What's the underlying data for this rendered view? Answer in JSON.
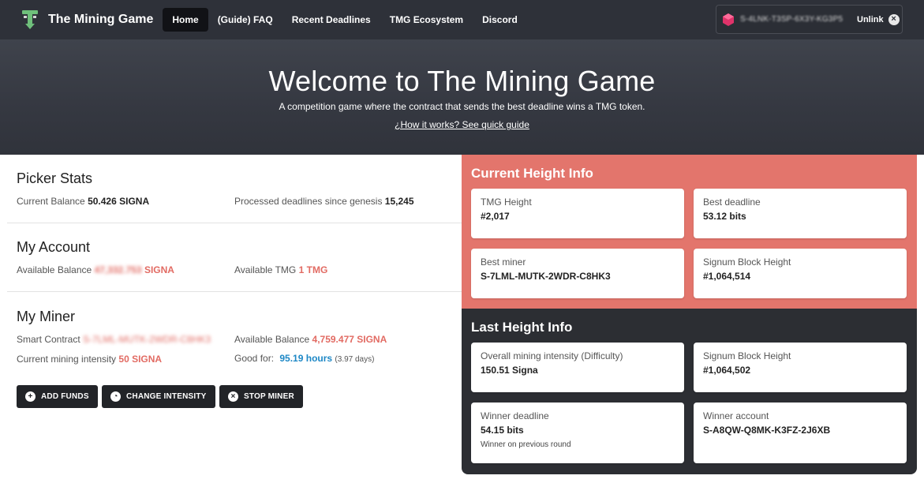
{
  "nav": {
    "brand": "The Mining Game",
    "links": [
      "Home",
      "(Guide) FAQ",
      "Recent Deadlines",
      "TMG Ecosystem",
      "Discord"
    ],
    "wallet_address": "S-4LNK-T3SP-6X3Y-KG3P5",
    "unlink_label": "Unlink"
  },
  "hero": {
    "title": "Welcome to The Mining Game",
    "subtitle": "A competition game where the contract that sends the best deadline wins a TMG token.",
    "guide_link": "¿How it works? See quick guide"
  },
  "picker_stats": {
    "title": "Picker Stats",
    "current_balance_label": "Current Balance",
    "current_balance_value": "50.426 SIGNA",
    "processed_label": "Processed deadlines since genesis",
    "processed_value": "15,245"
  },
  "my_account": {
    "title": "My Account",
    "available_balance_label": "Available Balance",
    "available_balance_value": "47,332.753",
    "available_balance_unit": "SIGNA",
    "available_tmg_label": "Available TMG",
    "available_tmg_value": "1 TMG"
  },
  "my_miner": {
    "title": "My Miner",
    "smart_contract_label": "Smart Contract",
    "smart_contract_value": "S-7LML-MUTK-2WDR-C8HK3",
    "available_balance_label": "Available Balance",
    "available_balance_value": "4,759.477 SIGNA",
    "intensity_label": "Current mining intensity",
    "intensity_value": "50 SIGNA",
    "good_for_label": "Good for:",
    "good_for_value": "95.19 hours",
    "good_for_days": "(3.97 days)"
  },
  "buttons": {
    "add_funds": "ADD FUNDS",
    "change_intensity": "CHANGE INTENSITY",
    "stop_miner": "STOP MINER"
  },
  "current_height": {
    "title": "Current Height Info",
    "tmg_height_label": "TMG Height",
    "tmg_height_value": "#2,017",
    "best_deadline_label": "Best deadline",
    "best_deadline_value": "53.12 bits",
    "best_miner_label": "Best miner",
    "best_miner_value": "S-7LML-MUTK-2WDR-C8HK3",
    "signum_block_label": "Signum Block Height",
    "signum_block_value": "#1,064,514"
  },
  "last_height": {
    "title": "Last Height Info",
    "intensity_label": "Overall mining intensity (Difficulty)",
    "intensity_value": "150.51 Signa",
    "signum_block_label": "Signum Block Height",
    "signum_block_value": "#1,064,502",
    "winner_deadline_label": "Winner deadline",
    "winner_deadline_value": "54.15 bits",
    "winner_deadline_note": "Winner on previous round",
    "winner_account_label": "Winner account",
    "winner_account_value": "S-A8QW-Q8MK-K3FZ-2J6XB"
  },
  "colors": {
    "navbar": "#2e3139",
    "accent_red": "#e3756c",
    "dark_panel": "#2c2e33",
    "link_blue": "#1e88c6"
  },
  "icons": {
    "logo": "tmg-logo-icon",
    "wallet": "signum-gem-icon",
    "unlink": "close-circle-icon",
    "add_funds": "plus-circle-icon",
    "change_intensity": "gauge-icon",
    "stop_miner": "close-circle-icon"
  }
}
